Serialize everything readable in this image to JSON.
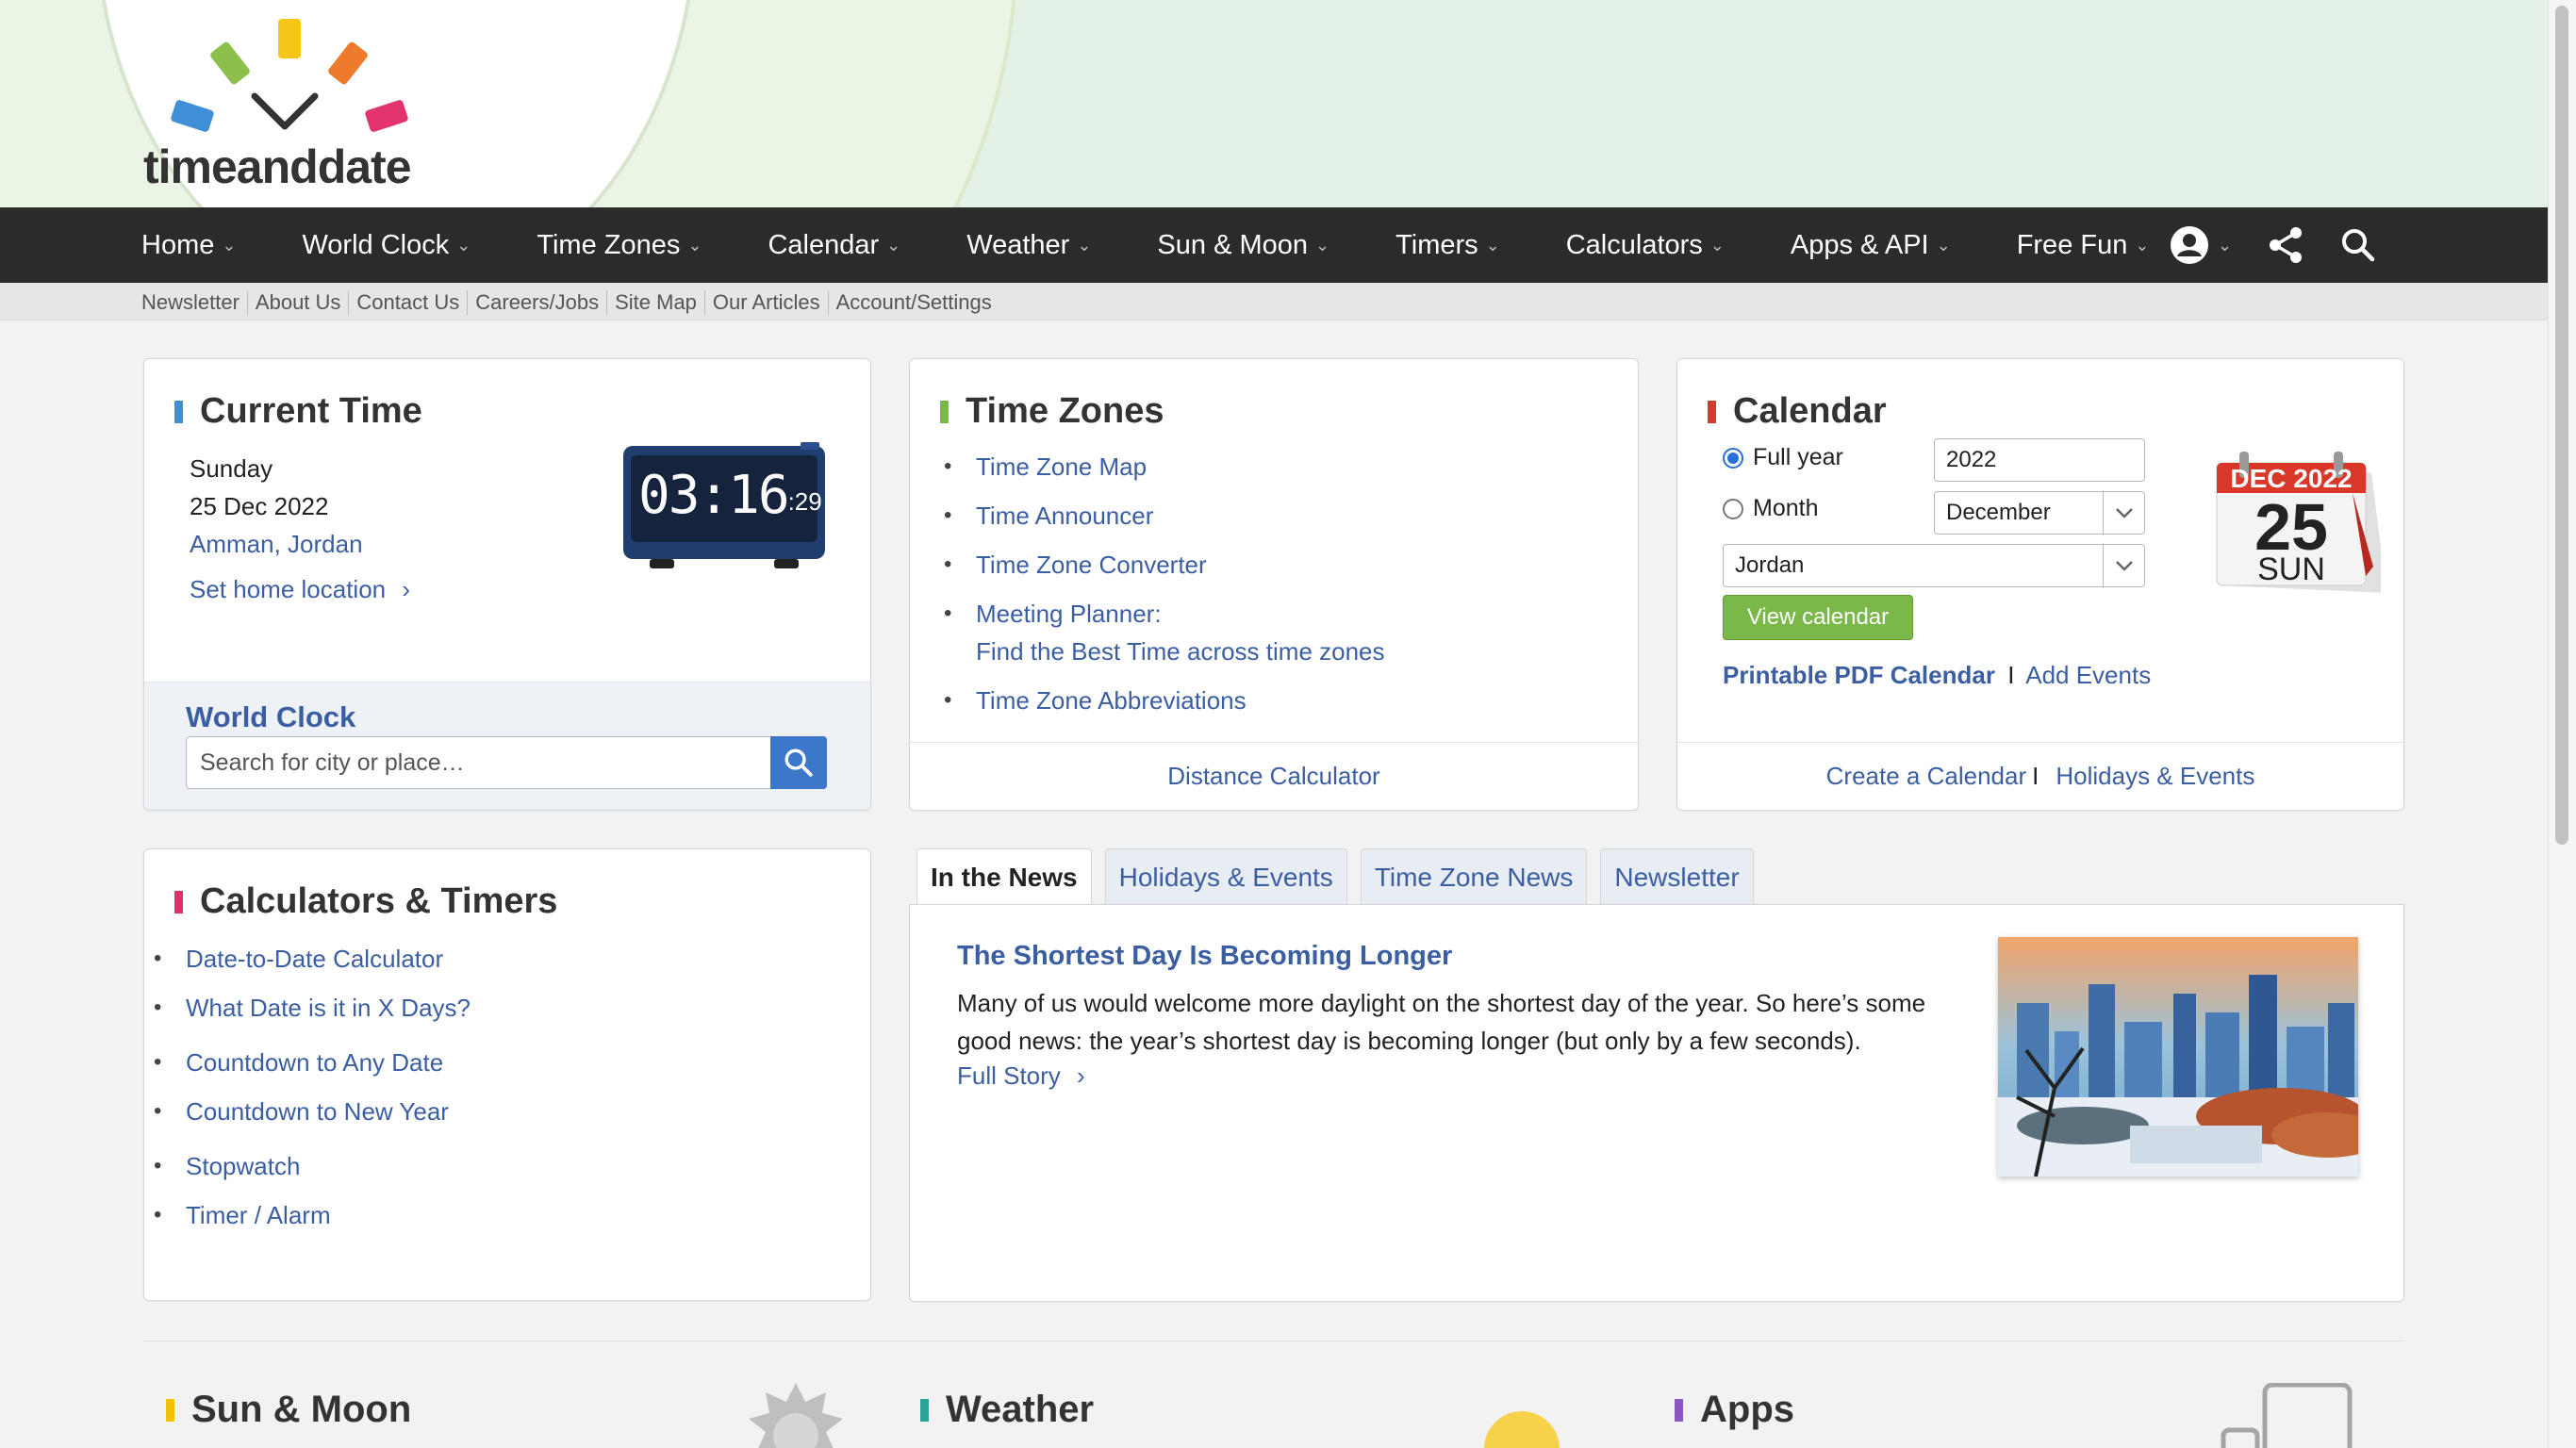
{
  "logo": {
    "text": "timeanddate"
  },
  "nav": {
    "items": [
      "Home",
      "World Clock",
      "Time Zones",
      "Calendar",
      "Weather",
      "Sun & Moon",
      "Timers",
      "Calculators",
      "Apps & API",
      "Free Fun"
    ]
  },
  "subnav": {
    "links": [
      "Newsletter",
      "About Us",
      "Contact Us",
      "Careers/Jobs",
      "Site Map",
      "Our Articles",
      "Account/Settings"
    ]
  },
  "current_time": {
    "title": "Current Time",
    "weekday": "Sunday",
    "date": "25 Dec 2022",
    "location": "Amman, Jordan",
    "set_home": "Set home location",
    "clock_hm": "03:16",
    "clock_s": ":29",
    "world_clock_title": "World Clock",
    "search_placeholder": "Search for city or place…"
  },
  "time_zones": {
    "title": "Time Zones",
    "links": [
      "Time Zone Map",
      "Time Announcer",
      "Time Zone Converter",
      "Meeting Planner:",
      "Find the Best Time across time zones",
      "Time Zone Abbreviations"
    ],
    "footer": "Distance Calculator"
  },
  "calendar": {
    "title": "Calendar",
    "full_year_label": "Full year",
    "month_label": "Month",
    "year_value": "2022",
    "month_value": "December",
    "country_value": "Jordan",
    "button": "View calendar",
    "printable": "Printable PDF Calendar",
    "separator": "I",
    "add_events": "Add Events",
    "footer_create": "Create a Calendar",
    "footer_holidays": "Holidays & Events",
    "icon_month_year": "DEC 2022",
    "icon_day": "25",
    "icon_weekday": "SUN"
  },
  "calculators": {
    "title": "Calculators & Timers",
    "links": [
      "Date-to-Date Calculator",
      "What Date is it in X Days?",
      "Countdown to Any Date",
      "Countdown to New Year",
      "Stopwatch",
      "Timer / Alarm"
    ]
  },
  "news": {
    "tabs": [
      "In the News",
      "Holidays & Events",
      "Time Zone News",
      "Newsletter"
    ],
    "headline": "The Shortest Day Is Becoming Longer",
    "body": "Many of us would welcome more daylight on the shortest day of the year. So here’s some good news: the year’s shortest day is becoming longer (but only by a few seconds).",
    "more": "Full Story"
  },
  "bottom": {
    "sun_moon": "Sun & Moon",
    "weather": "Weather",
    "apps": "Apps"
  },
  "colors": {
    "nav_bg": "#2b2b2b",
    "link": "#3b5ea3",
    "accent_green": "#7bb84a",
    "bar_current_time": "#3f8fd6",
    "bar_time_zones": "#7bb84a",
    "bar_calendar": "#d23a32",
    "bar_calculators": "#d8336e",
    "bar_sun_moon": "#f2c200",
    "bar_weather": "#2aa39b",
    "bar_apps": "#8a56c2"
  }
}
